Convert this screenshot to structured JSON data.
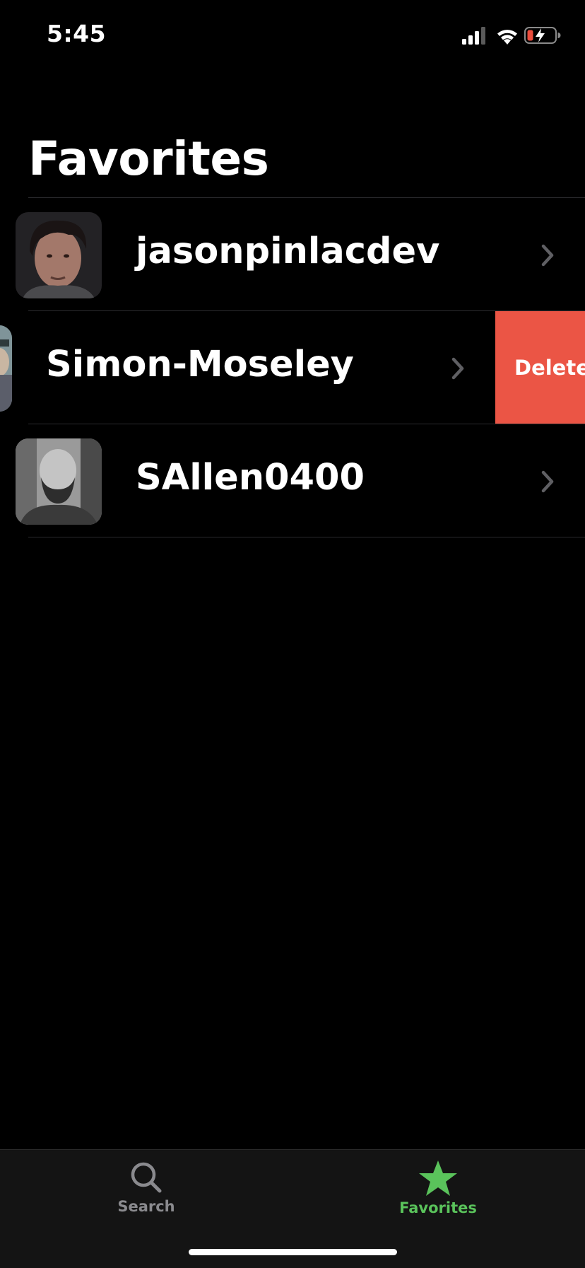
{
  "status_bar": {
    "time": "5:45",
    "icons": [
      "cellular-signal-icon",
      "wifi-icon",
      "battery-charging-icon"
    ],
    "battery_color": "#eb4d3d"
  },
  "header": {
    "title": "Favorites"
  },
  "favorites": [
    {
      "username": "jasonpinlacdev",
      "swiped": false
    },
    {
      "username": "Simon-Moseley",
      "swiped": true,
      "action_label": "Delete"
    },
    {
      "username": "SAllen0400",
      "swiped": false
    }
  ],
  "tab_bar": {
    "tabs": [
      {
        "label": "Search",
        "icon": "search-icon",
        "selected": false
      },
      {
        "label": "Favorites",
        "icon": "star-icon",
        "selected": true
      }
    ]
  },
  "colors": {
    "accent": "#5ac35b",
    "delete": "#eb5545",
    "inactive_tab": "#8a8a8e"
  }
}
